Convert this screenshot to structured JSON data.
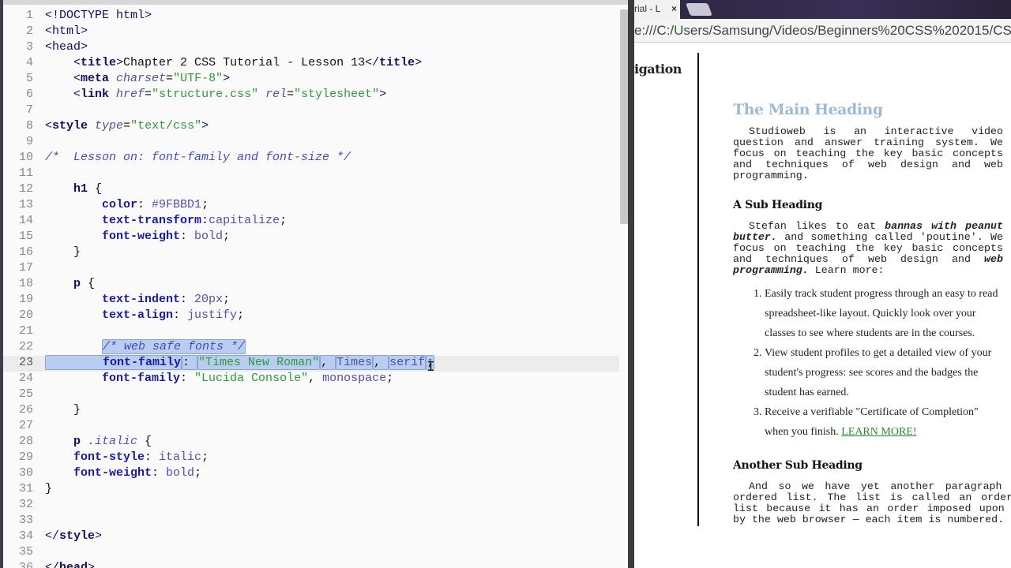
{
  "editor": {
    "current_line": 23,
    "lines": [
      [
        [
          "<!DOCTYPE html>",
          "tagn"
        ]
      ],
      [
        [
          "<html>",
          "tagn"
        ]
      ],
      [
        [
          "<head>",
          "tagn"
        ]
      ],
      [
        [
          "    <",
          "tagn"
        ],
        [
          "title",
          "tag"
        ],
        [
          ">",
          "tagn"
        ],
        [
          "Chapter 2 CSS Tutorial - Lesson 13",
          "pun"
        ],
        [
          "</",
          "tagn"
        ],
        [
          "title",
          "tag"
        ],
        [
          ">",
          "tagn"
        ]
      ],
      [
        [
          "    <",
          "tagn"
        ],
        [
          "meta",
          "tag"
        ],
        [
          " charset",
          "attr"
        ],
        [
          "=",
          "pun"
        ],
        [
          "\"UTF-8\"",
          "str"
        ],
        [
          ">",
          "tagn"
        ]
      ],
      [
        [
          "    <",
          "tagn"
        ],
        [
          "link",
          "tag"
        ],
        [
          " href",
          "attr"
        ],
        [
          "=",
          "pun"
        ],
        [
          "\"structure.css\"",
          "str"
        ],
        [
          " rel",
          "attr"
        ],
        [
          "=",
          "pun"
        ],
        [
          "\"stylesheet\"",
          "str"
        ],
        [
          ">",
          "tagn"
        ]
      ],
      [],
      [
        [
          "<",
          "tagn"
        ],
        [
          "style",
          "tag"
        ],
        [
          " type",
          "attr"
        ],
        [
          "=",
          "pun"
        ],
        [
          "\"text/css\"",
          "str"
        ],
        [
          ">",
          "tagn"
        ]
      ],
      [],
      [
        [
          "/*  Lesson on: font-family and font-size */",
          "com"
        ]
      ],
      [],
      [
        [
          "    h1",
          "tag"
        ],
        [
          " {",
          "pun"
        ]
      ],
      [
        [
          "        color",
          "prop"
        ],
        [
          ": ",
          "pun"
        ],
        [
          "#9FBBD1",
          "val"
        ],
        [
          ";",
          "pun"
        ]
      ],
      [
        [
          "        text-transform",
          "prop"
        ],
        [
          ":",
          "pun"
        ],
        [
          "capitalize",
          "val"
        ],
        [
          ";",
          "pun"
        ]
      ],
      [
        [
          "        font-weight",
          "prop"
        ],
        [
          ": ",
          "pun"
        ],
        [
          "bold",
          "val"
        ],
        [
          ";",
          "pun"
        ]
      ],
      [
        [
          "    }",
          "pun"
        ]
      ],
      [],
      [
        [
          "    p",
          "tag"
        ],
        [
          " {",
          "pun"
        ]
      ],
      [
        [
          "        text-indent",
          "prop"
        ],
        [
          ": ",
          "pun"
        ],
        [
          "20px",
          "val"
        ],
        [
          ";",
          "pun"
        ]
      ],
      [
        [
          "        text-align",
          "prop"
        ],
        [
          ": ",
          "pun"
        ],
        [
          "justify",
          "val"
        ],
        [
          ";",
          "pun"
        ]
      ],
      [],
      [
        [
          "        ",
          "pun"
        ],
        [
          "/* web safe fonts */",
          "com",
          "sel"
        ]
      ],
      [
        [
          "        font-family",
          "prop",
          "sel"
        ],
        [
          ": ",
          "pun",
          "sel"
        ],
        [
          "\"Times New Roman\"",
          "str",
          "sel"
        ],
        [
          ", ",
          "pun",
          "sel"
        ],
        [
          "Times",
          "val",
          "sel"
        ],
        [
          ", ",
          "pun",
          "sel"
        ],
        [
          "serif",
          "val",
          "sel"
        ],
        [
          ";",
          "pun",
          "sel"
        ]
      ],
      [
        [
          "        font-family",
          "prop"
        ],
        [
          ": ",
          "pun"
        ],
        [
          "\"Lucida Console\"",
          "str"
        ],
        [
          ", ",
          "pun"
        ],
        [
          "monospace",
          "val"
        ],
        [
          ";",
          "pun"
        ]
      ],
      [],
      [
        [
          "    }",
          "pun"
        ]
      ],
      [],
      [
        [
          "    p ",
          "tag"
        ],
        [
          ".italic",
          "attr"
        ],
        [
          " {",
          "pun"
        ]
      ],
      [
        [
          "    font-style",
          "prop"
        ],
        [
          ": ",
          "pun"
        ],
        [
          "italic",
          "val"
        ],
        [
          ";",
          "pun"
        ]
      ],
      [
        [
          "    font-weight",
          "prop"
        ],
        [
          ": ",
          "pun"
        ],
        [
          "bold",
          "val"
        ],
        [
          ";",
          "pun"
        ]
      ],
      [
        [
          "}",
          "pun"
        ]
      ],
      [],
      [],
      [
        [
          "</",
          "tagn"
        ],
        [
          "style",
          "tag"
        ],
        [
          ">",
          "tagn"
        ]
      ],
      [],
      [
        [
          "</",
          "tagn"
        ],
        [
          "head",
          "tag"
        ],
        [
          ">",
          "tagn"
        ]
      ]
    ]
  },
  "browser": {
    "tab_title": "rial - L",
    "tab_close": "×",
    "address_prefix": "e:///C:/",
    "address_user": "U",
    "address_rest": "sers/Samsung/Videos/Beginners%20CSS%202015/CSS%202",
    "nav_heading": "igation",
    "h1": "The Main Heading",
    "p1": "Studioweb is an interactive video question and answer training system. We focus on teaching the key basic concepts and techniques of web design and web programming.",
    "sub1": "A Sub Heading",
    "p2_a": "Stefan likes to eat ",
    "p2_b": "bannas with peanut butter.",
    "p2_c": " and something called 'poutine'. We focus on teaching the key basic concepts and techniques of web design and ",
    "p2_d": "web programming.",
    "p2_e": " Learn more:",
    "list": [
      "Easily track student progress through an easy to read spreadsheet-like layout. Quickly look over your classes to see where students are in the courses.",
      "View student profiles to get a detailed view of your student's progress: see scores and the badges the student has earned.",
      "Receive a verifiable \"Certificate of Completion\" when you finish. "
    ],
    "learn_more": "LEARN MORE!",
    "sub2": "Another Sub Heading",
    "p3": "And so we have yet another paragraph of ordered list. The list is called an ordered list because it has an order imposed upon it by the web browser — each item is numbered."
  }
}
